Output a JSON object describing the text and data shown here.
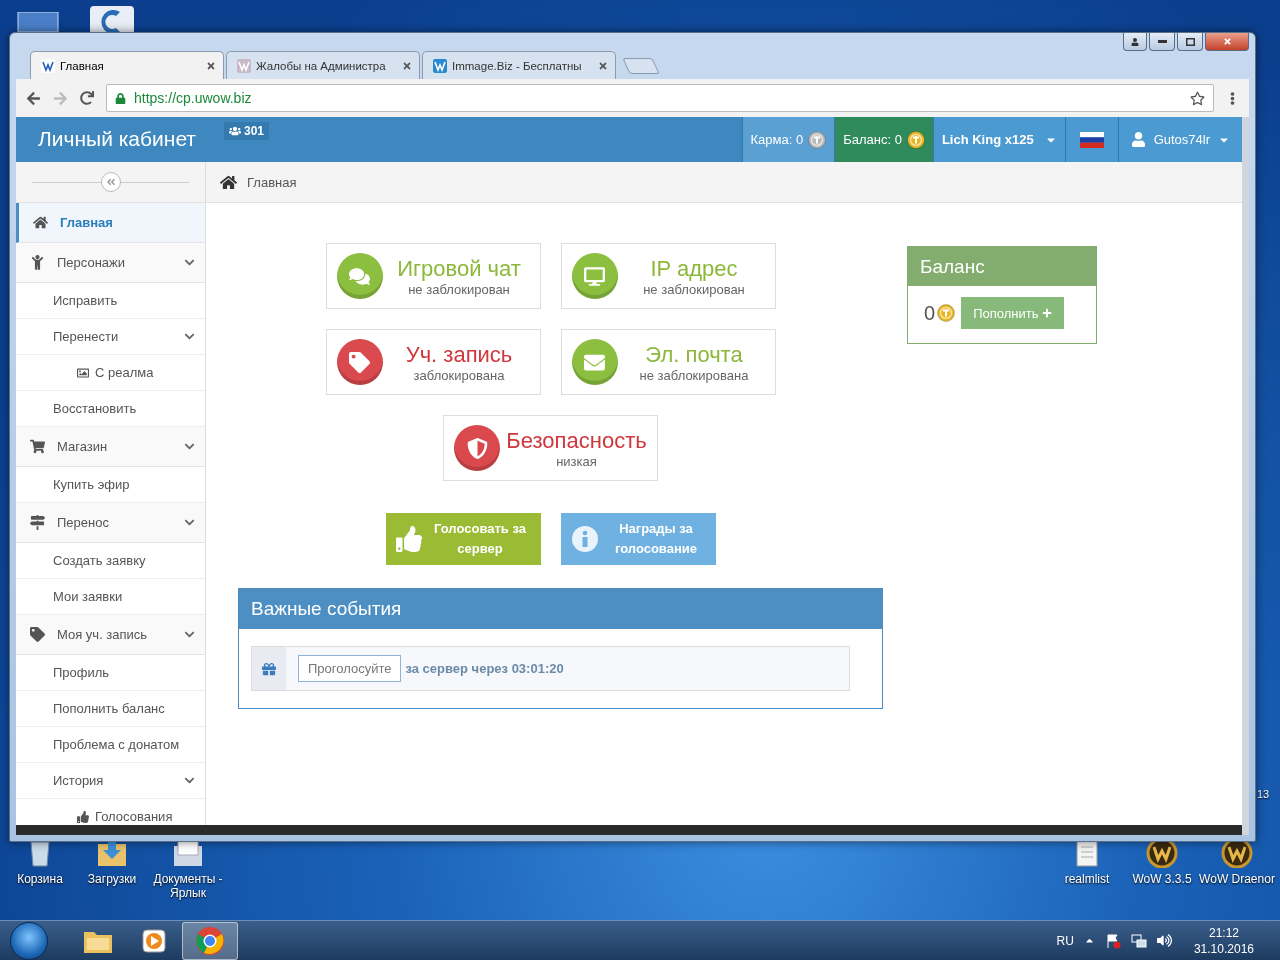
{
  "desktop": {
    "icons": [
      {
        "label": "Корзина",
        "kind": "bin"
      },
      {
        "label": "Загрузки",
        "kind": "downloads"
      },
      {
        "label": "Документы - Ярлык",
        "kind": "documents"
      },
      {
        "label": "realmlist",
        "kind": "textfile"
      },
      {
        "label": "WoW 3.3.5",
        "kind": "game"
      },
      {
        "label": "WoW Draenor",
        "kind": "game"
      }
    ],
    "edge_text": "13"
  },
  "browser": {
    "tabs": [
      {
        "title": "Главная",
        "selected": true
      },
      {
        "title": "Жалобы на Администра",
        "selected": false
      },
      {
        "title": "Immage.Biz - Бесплатны",
        "selected": false
      }
    ],
    "url": "https://cp.uwow.biz"
  },
  "header": {
    "brand": "Личный кабинет",
    "online": "301",
    "karma": "Карма: 0",
    "balance": "Баланс: 0",
    "realm": "Lich King x125",
    "user": "Gutos74lr"
  },
  "sidebar": {
    "items": [
      {
        "label": "Главная",
        "kind": "home",
        "selected": true
      },
      {
        "label": "Персонажи",
        "kind": "character",
        "selected": false,
        "expanded": true,
        "children": [
          {
            "label": "Исправить",
            "selected": false
          },
          {
            "label": "Перенести",
            "selected": false,
            "expanded": true,
            "children": [
              {
                "label": "С реалма",
                "kind": "image",
                "selected": false
              }
            ]
          },
          {
            "label": "Восстановить",
            "selected": false
          }
        ]
      },
      {
        "label": "Магазин",
        "kind": "cart",
        "selected": false,
        "expanded": true,
        "children": [
          {
            "label": "Купить эфир",
            "selected": false
          }
        ]
      },
      {
        "label": "Перенос",
        "kind": "signpost",
        "selected": false,
        "expanded": true,
        "children": [
          {
            "label": "Создать заявку",
            "selected": false
          },
          {
            "label": "Мои заявки",
            "selected": false
          }
        ]
      },
      {
        "label": "Моя уч. запись",
        "kind": "tag",
        "selected": false,
        "expanded": true,
        "children": [
          {
            "label": "Профиль",
            "selected": false
          },
          {
            "label": "Пополнить баланс",
            "selected": false
          },
          {
            "label": "Проблема с донатом",
            "selected": false
          },
          {
            "label": "История",
            "selected": false,
            "expanded": true,
            "children": [
              {
                "label": "Голосования",
                "kind": "vote",
                "selected": false
              }
            ]
          }
        ]
      }
    ]
  },
  "breadcrumb": "Главная",
  "status_cards": [
    {
      "title": "Игровой чат",
      "subtitle": "не заблокирован",
      "kind": "ok"
    },
    {
      "title": "IP адрес",
      "subtitle": "не заблокирован",
      "kind": "ok"
    },
    {
      "title": "Уч. запись",
      "subtitle": "заблокирована",
      "kind": "alert"
    },
    {
      "title": "Эл. почта",
      "subtitle": "не заблокирована",
      "kind": "ok"
    },
    {
      "title": "Безопасность",
      "subtitle": "низкая",
      "kind": "alert"
    }
  ],
  "vote_buttons": [
    {
      "label": "Голосовать за сервер",
      "kind": "vote"
    },
    {
      "label": "Награды за голосование",
      "kind": "info"
    }
  ],
  "balance_panel": {
    "title": "Баланс",
    "amount": "0",
    "button": "Пополнить"
  },
  "events": {
    "title": "Важные события",
    "items": [
      {
        "button": "Проголосуйте",
        "text": "за сервер через 03:01:20"
      }
    ]
  },
  "taskbar": {
    "apps": [
      {
        "kind": "folder",
        "selected": false
      },
      {
        "kind": "player",
        "selected": false
      },
      {
        "kind": "browser",
        "selected": true
      }
    ],
    "language": "RU",
    "time": "21:12",
    "date": "31.10.2016"
  }
}
